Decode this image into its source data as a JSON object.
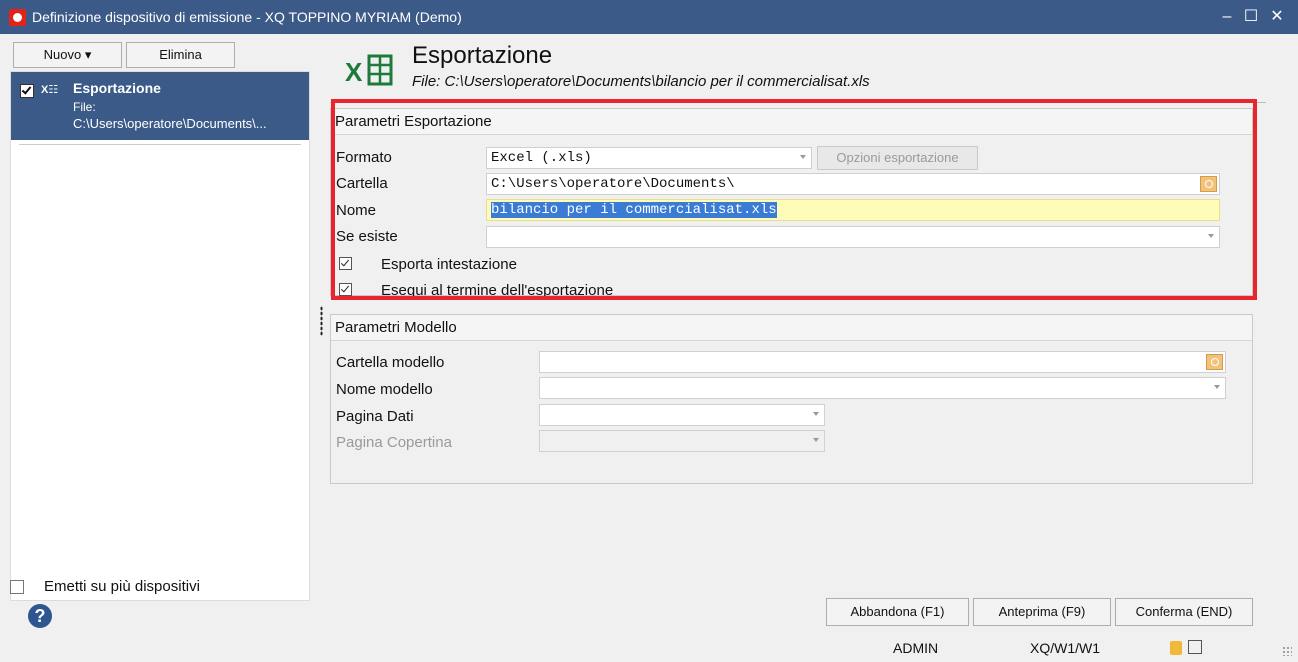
{
  "window": {
    "title": "Definizione dispositivo di emissione - XQ TOPPINO MYRIAM  (Demo)",
    "controls": {
      "minimize": "‒",
      "maximize": "☐",
      "close": "✕"
    }
  },
  "sidebar": {
    "new_button": "Nuovo ▾",
    "delete_button": "Elimina",
    "devices": [
      {
        "name": "Esportazione",
        "file_label": "File:",
        "file_path": "C:\\Users\\operatore\\Documents\\...",
        "checked": true,
        "icon": "excel-icon"
      }
    ],
    "multi_device_label": "Emetti su più dispositivi",
    "multi_device_checked": false
  },
  "header": {
    "title": "Esportazione",
    "file": "File: C:\\Users\\operatore\\Documents\\bilancio per il commercialisat.xls",
    "icon": "excel-icon"
  },
  "export_params": {
    "title": "Parametri Esportazione",
    "format_label": "Formato",
    "format_value": "Excel (.xls)",
    "export_options_button": "Opzioni esportazione",
    "folder_label": "Cartella",
    "folder_value": "C:\\Users\\operatore\\Documents\\",
    "name_label": "Nome",
    "name_value": "bilancio per il commercialisat.xls",
    "if_exists_label": "Se esiste",
    "if_exists_value": "",
    "export_header_label": "Esporta intestazione",
    "export_header_checked": true,
    "run_after_label": "Esequi al termine dell'esportazione",
    "run_after_checked": true
  },
  "model_params": {
    "title": "Parametri Modello",
    "model_folder_label": "Cartella modello",
    "model_name_label": "Nome modello",
    "data_page_label": "Pagina Dati",
    "cover_page_label": "Pagina Copertina"
  },
  "footer": {
    "cancel_button": "Abbandona (F1)",
    "preview_button": "Anteprima (F9)",
    "confirm_button": "Conferma (END)",
    "help_icon": "?",
    "user": "ADMIN",
    "workstation": "XQ/W1/W1"
  },
  "colors": {
    "titlebar": "#3c5a88",
    "selection": "#3b5a87",
    "highlight_field": "#fefcb8",
    "red_frame": "#e8242d"
  }
}
